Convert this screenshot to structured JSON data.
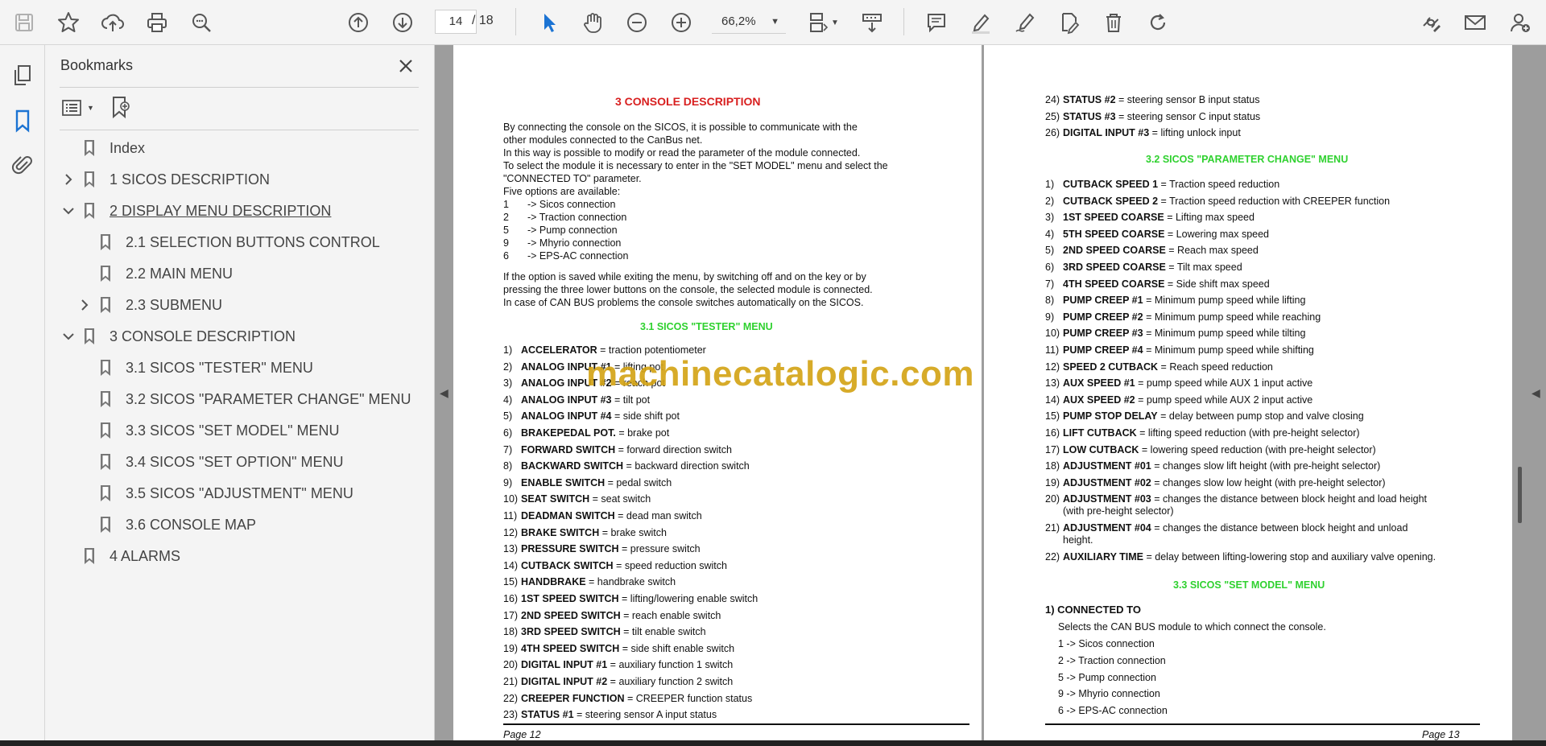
{
  "toolbar": {
    "page_current": "14",
    "page_total": "/ 18",
    "zoom": "66,2%"
  },
  "bookmarks_panel": {
    "title": "Bookmarks",
    "items": [
      {
        "label": "Index"
      },
      {
        "label": "1 SICOS DESCRIPTION"
      },
      {
        "label": "2 DISPLAY MENU DESCRIPTION"
      },
      {
        "label": "2.1 SELECTION BUTTONS CONTROL"
      },
      {
        "label": "2.2 MAIN MENU"
      },
      {
        "label": "2.3 SUBMENU"
      },
      {
        "label": "3 CONSOLE DESCRIPTION"
      },
      {
        "label": "3.1 SICOS \"TESTER\" MENU"
      },
      {
        "label": "3.2 SICOS \"PARAMETER CHANGE\" MENU"
      },
      {
        "label": "3.3 SICOS \"SET MODEL\" MENU"
      },
      {
        "label": "3.4 SICOS \"SET OPTION\" MENU"
      },
      {
        "label": "3.5 SICOS \"ADJUSTMENT\" MENU"
      },
      {
        "label": "3.6 CONSOLE MAP"
      },
      {
        "label": "4 ALARMS"
      }
    ]
  },
  "watermark": "machinecatalogic.com",
  "page12": {
    "heading": "3 CONSOLE DESCRIPTION",
    "intro": [
      "By connecting the console on the SICOS, it is possible to communicate with the",
      "other modules connected to the CanBus net.",
      "In this way is possible to modify or read the parameter of the module connected.",
      "To select the module it is necessary to enter in the \"SET MODEL\" menu and select the",
      "\"CONNECTED TO\" parameter.",
      "Five options are available:"
    ],
    "options": [
      {
        "num": "1",
        "text": "-> Sicos connection"
      },
      {
        "num": "2",
        "text": "-> Traction connection"
      },
      {
        "num": "5",
        "text": "-> Pump connection"
      },
      {
        "num": "9",
        "text": "-> Mhyrio connection"
      },
      {
        "num": "6",
        "text": "-> EPS-AC connection"
      }
    ],
    "note": [
      "If the option is saved while exiting the menu, by switching off and on the key or by",
      "pressing the three lower buttons on the console, the selected module is connected.",
      "In case of CAN BUS problems the console switches automatically on the SICOS."
    ],
    "sub_heading": "3.1 SICOS \"TESTER\" MENU",
    "tester_items": [
      {
        "num": "1)",
        "bold": "ACCELERATOR",
        "rest": " = traction potentiometer"
      },
      {
        "num": "2)",
        "bold": "ANALOG INPUT #1",
        "rest": " = lifting pot"
      },
      {
        "num": "3)",
        "bold": "ANALOG INPUT #2",
        "rest": " = reach pot"
      },
      {
        "num": "4)",
        "bold": "ANALOG INPUT #3",
        "rest": " = tilt pot"
      },
      {
        "num": "5)",
        "bold": "ANALOG INPUT #4",
        "rest": " = side shift pot"
      },
      {
        "num": "6)",
        "bold": "BRAKEPEDAL POT.",
        "rest": " = brake pot"
      },
      {
        "num": "7)",
        "bold": "FORWARD SWITCH",
        "rest": " = forward direction switch"
      },
      {
        "num": "8)",
        "bold": "BACKWARD SWITCH",
        "rest": " = backward direction switch"
      },
      {
        "num": "9)",
        "bold": "ENABLE SWITCH",
        "rest": " = pedal switch"
      },
      {
        "num": "10)",
        "bold": "SEAT SWITCH",
        "rest": " = seat switch"
      },
      {
        "num": "11)",
        "bold": "DEADMAN SWITCH",
        "rest": " = dead man switch"
      },
      {
        "num": "12)",
        "bold": "BRAKE SWITCH",
        "rest": " = brake switch"
      },
      {
        "num": "13)",
        "bold": "PRESSURE SWITCH",
        "rest": " = pressure switch"
      },
      {
        "num": "14)",
        "bold": "CUTBACK SWITCH",
        "rest": " = speed reduction switch"
      },
      {
        "num": "15)",
        "bold": "HANDBRAKE",
        "rest": " = handbrake switch"
      },
      {
        "num": "16)",
        "bold": "1ST SPEED SWITCH",
        "rest": " = lifting/lowering enable switch"
      },
      {
        "num": "17)",
        "bold": "2ND SPEED SWITCH",
        "rest": " = reach enable switch"
      },
      {
        "num": "18)",
        "bold": "3RD SPEED SWITCH",
        "rest": " = tilt enable switch"
      },
      {
        "num": "19)",
        "bold": "4TH SPEED SWITCH",
        "rest": " = side shift enable switch"
      },
      {
        "num": "20)",
        "bold": "DIGITAL INPUT #1",
        "rest": " = auxiliary function 1 switch"
      },
      {
        "num": "21)",
        "bold": "DIGITAL INPUT #2",
        "rest": " = auxiliary function 2 switch"
      },
      {
        "num": "22)",
        "bold": "CREEPER FUNCTION",
        "rest": " = CREEPER function status"
      },
      {
        "num": "23)",
        "bold": "STATUS #1",
        "rest": " = steering sensor A input status"
      }
    ],
    "footer": "Page 12"
  },
  "page13": {
    "top_items": [
      {
        "num": "24)",
        "bold": "STATUS #2",
        "rest": " = steering sensor B input status"
      },
      {
        "num": "25)",
        "bold": "STATUS #3",
        "rest": " = steering sensor C input status"
      },
      {
        "num": "26)",
        "bold": "DIGITAL INPUT #3",
        "rest": " = lifting unlock input"
      }
    ],
    "param_heading": "3.2 SICOS \"PARAMETER CHANGE\" MENU",
    "param_items": [
      {
        "num": "1)",
        "bold": "CUTBACK SPEED 1",
        "rest": " = Traction speed reduction"
      },
      {
        "num": "2)",
        "bold": "CUTBACK SPEED 2",
        "rest": " = Traction speed reduction with CREEPER function"
      },
      {
        "num": "3)",
        "bold": "1ST SPEED COARSE",
        "rest": " = Lifting max speed"
      },
      {
        "num": "4)",
        "bold": "5TH SPEED COARSE",
        "rest": " = Lowering max speed"
      },
      {
        "num": "5)",
        "bold": "2ND SPEED COARSE",
        "rest": " = Reach max speed"
      },
      {
        "num": "6)",
        "bold": "3RD SPEED COARSE",
        "rest": " = Tilt max speed"
      },
      {
        "num": "7)",
        "bold": "4TH SPEED COARSE",
        "rest": " = Side shift max speed"
      },
      {
        "num": "8)",
        "bold": "PUMP CREEP #1",
        "rest": " = Minimum pump speed while lifting"
      },
      {
        "num": "9)",
        "bold": "PUMP CREEP #2",
        "rest": " = Minimum pump speed while reaching"
      },
      {
        "num": "10)",
        "bold": "PUMP CREEP #3",
        "rest": " = Minimum pump speed while tilting"
      },
      {
        "num": "11)",
        "bold": "PUMP CREEP #4",
        "rest": " = Minimum pump speed while shifting"
      },
      {
        "num": "12)",
        "bold": "SPEED 2 CUTBACK",
        "rest": " = Reach speed reduction"
      },
      {
        "num": "13)",
        "bold": "AUX SPEED #1",
        "rest": " = pump speed while AUX 1 input active"
      },
      {
        "num": "14)",
        "bold": "AUX SPEED #2",
        "rest": " = pump speed while AUX 2 input active"
      },
      {
        "num": "15)",
        "bold": "PUMP STOP DELAY",
        "rest": " = delay between pump stop and valve closing"
      },
      {
        "num": "16)",
        "bold": "LIFT CUTBACK",
        "rest": " = lifting speed reduction (with pre-height selector)"
      },
      {
        "num": "17)",
        "bold": "LOW CUTBACK",
        "rest": " = lowering speed reduction (with pre-height selector)"
      },
      {
        "num": "18)",
        "bold": "ADJUSTMENT #01",
        "rest": " = changes slow lift height (with pre-height selector)"
      },
      {
        "num": "19)",
        "bold": "ADJUSTMENT #02",
        "rest": " = changes slow low height (with pre-height selector)"
      },
      {
        "num": "20)",
        "bold": "ADJUSTMENT #03",
        "rest": " = changes the distance between block height and load height",
        "cont": "(with pre-height selector)"
      },
      {
        "num": "21)",
        "bold": "ADJUSTMENT #04",
        "rest": " = changes the distance between block height and unload",
        "cont": "height."
      },
      {
        "num": "22)",
        "bold": "AUXILIARY TIME",
        "rest": " = delay between lifting-lowering stop and auxiliary valve opening."
      }
    ],
    "setmodel_heading": "3.3 SICOS \"SET MODEL\" MENU",
    "connected_title": "1) CONNECTED TO",
    "connected_desc": "Selects the CAN BUS module to which connect the console.",
    "connected_options": [
      "1 -> Sicos connection",
      "2 -> Traction connection",
      "5 -> Pump connection",
      "9 -> Mhyrio connection",
      "6 -> EPS-AC connection"
    ],
    "footer": "Page 13"
  }
}
